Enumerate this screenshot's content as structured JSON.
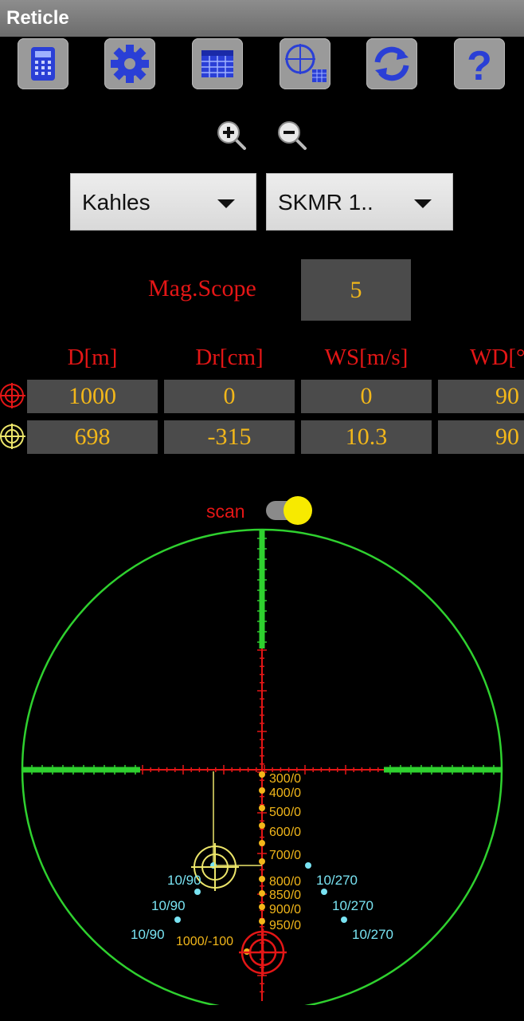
{
  "app": {
    "title": "Reticle"
  },
  "toolbar": {
    "buttons": [
      {
        "icon": "calculator-icon"
      },
      {
        "icon": "gear-icon"
      },
      {
        "icon": "table-icon"
      },
      {
        "icon": "reticle-table-icon"
      },
      {
        "icon": "refresh-icon"
      },
      {
        "icon": "help-icon"
      }
    ]
  },
  "zoom": {
    "in_icon": "zoom-in-icon",
    "out_icon": "zoom-out-icon"
  },
  "selects": {
    "brand": "Kahles",
    "model": "SKMR 1.."
  },
  "magnification": {
    "label": "Mag.Scope",
    "value": "5"
  },
  "table": {
    "headers": [
      "D[m]",
      "Dr[cm]",
      "WS[m/s]",
      "WD[°"
    ],
    "rows": [
      {
        "icon": "red-target-icon",
        "cells": [
          "1000",
          "0",
          "0",
          "90"
        ]
      },
      {
        "icon": "yellow-target-icon",
        "cells": [
          "698",
          "-315",
          "10.3",
          "90"
        ]
      }
    ]
  },
  "scan": {
    "label": "scan",
    "enabled": true
  },
  "reticle": {
    "drop_labels": [
      "300/0",
      "400/0",
      "500/0",
      "600/0",
      "700/0",
      "800/0",
      "850/0",
      "900/0",
      "950/0",
      "1000/-100"
    ],
    "wind_left_labels": [
      "10/90",
      "10/90",
      "10/90"
    ],
    "wind_right_labels": [
      "10/270",
      "10/270",
      "10/270"
    ],
    "colors": {
      "circle": "#2fd12f",
      "stadia": "#e41616",
      "drop_dots": "#f2b71a",
      "wind_dots": "#79e3f2",
      "red_target": "#e41616",
      "yellow_target": "#ece56a"
    }
  }
}
